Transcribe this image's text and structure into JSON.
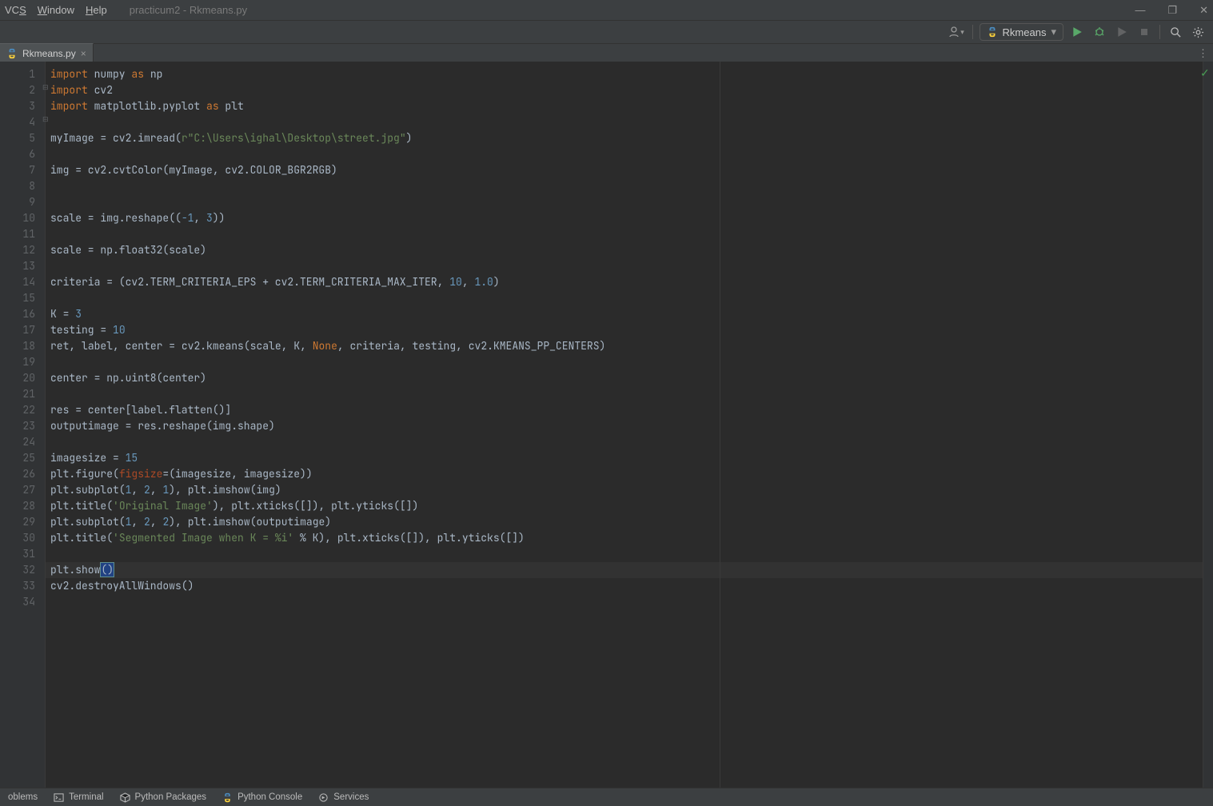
{
  "menu": {
    "vcs": "VCS",
    "window": "Window",
    "help": "Help",
    "project": "practicum2 - Rkmeans.py"
  },
  "winctl": {
    "min": "—",
    "max": "❐",
    "close": "✕"
  },
  "toolbar": {
    "run_config": "Rkmeans"
  },
  "tab": {
    "name": "Rkmeans.py"
  },
  "status": {
    "problems": "oblems",
    "terminal": "Terminal",
    "pypkg": "Python Packages",
    "pyconsole": "Python Console",
    "services": "Services"
  },
  "code_lines": [
    {
      "n": 1,
      "fold": true,
      "seg": [
        {
          "t": "import ",
          "c": "kw"
        },
        {
          "t": "numpy ",
          "c": "def"
        },
        {
          "t": "as ",
          "c": "kw"
        },
        {
          "t": "np",
          "c": "def"
        }
      ]
    },
    {
      "n": 2,
      "seg": [
        {
          "t": "import ",
          "c": "kw"
        },
        {
          "t": "cv2",
          "c": "def"
        }
      ]
    },
    {
      "n": 3,
      "fold": true,
      "seg": [
        {
          "t": "import ",
          "c": "kw"
        },
        {
          "t": "matplotlib.pyplot ",
          "c": "def"
        },
        {
          "t": "as ",
          "c": "kw"
        },
        {
          "t": "plt",
          "c": "def"
        }
      ]
    },
    {
      "n": 4,
      "seg": []
    },
    {
      "n": 5,
      "seg": [
        {
          "t": "myImage = cv2.imread(",
          "c": "def"
        },
        {
          "t": "r\"C:\\Users\\ighal\\Desktop\\street.jpg\"",
          "c": "str"
        },
        {
          "t": ")",
          "c": "def"
        }
      ]
    },
    {
      "n": 6,
      "seg": []
    },
    {
      "n": 7,
      "seg": [
        {
          "t": "img = cv2.cvtColor(myImage",
          "c": "def"
        },
        {
          "t": ", ",
          "c": "op"
        },
        {
          "t": "cv2.COLOR_BGR2RGB)",
          "c": "def"
        }
      ]
    },
    {
      "n": 8,
      "seg": []
    },
    {
      "n": 9,
      "seg": []
    },
    {
      "n": 10,
      "seg": [
        {
          "t": "scale = img.reshape((",
          "c": "def"
        },
        {
          "t": "-1",
          "c": "num"
        },
        {
          "t": ", ",
          "c": "op"
        },
        {
          "t": "3",
          "c": "num"
        },
        {
          "t": "))",
          "c": "def"
        }
      ]
    },
    {
      "n": 11,
      "seg": []
    },
    {
      "n": 12,
      "seg": [
        {
          "t": "scale = np.float32(scale)",
          "c": "def"
        }
      ]
    },
    {
      "n": 13,
      "seg": []
    },
    {
      "n": 14,
      "seg": [
        {
          "t": "criteria = (cv2.TERM_CRITERIA_EPS + cv2.TERM_CRITERIA_MAX_ITER",
          "c": "def"
        },
        {
          "t": ", ",
          "c": "op"
        },
        {
          "t": "10",
          "c": "num"
        },
        {
          "t": ", ",
          "c": "op"
        },
        {
          "t": "1.0",
          "c": "num"
        },
        {
          "t": ")",
          "c": "def"
        }
      ]
    },
    {
      "n": 15,
      "seg": []
    },
    {
      "n": 16,
      "seg": [
        {
          "t": "K = ",
          "c": "def"
        },
        {
          "t": "3",
          "c": "num"
        }
      ]
    },
    {
      "n": 17,
      "seg": [
        {
          "t": "testing = ",
          "c": "def"
        },
        {
          "t": "10",
          "c": "num"
        }
      ]
    },
    {
      "n": 18,
      "seg": [
        {
          "t": "ret",
          "c": "def"
        },
        {
          "t": ", ",
          "c": "op"
        },
        {
          "t": "label",
          "c": "def"
        },
        {
          "t": ", ",
          "c": "op"
        },
        {
          "t": "center = cv2.kmeans(scale",
          "c": "def"
        },
        {
          "t": ", ",
          "c": "op"
        },
        {
          "t": "K",
          "c": "def"
        },
        {
          "t": ", ",
          "c": "op"
        },
        {
          "t": "None",
          "c": "builtin"
        },
        {
          "t": ", ",
          "c": "op"
        },
        {
          "t": "criteria",
          "c": "def"
        },
        {
          "t": ", ",
          "c": "op"
        },
        {
          "t": "testing",
          "c": "def"
        },
        {
          "t": ", ",
          "c": "op"
        },
        {
          "t": "cv2.KMEANS_PP_CENTERS)",
          "c": "def"
        }
      ]
    },
    {
      "n": 19,
      "seg": []
    },
    {
      "n": 20,
      "seg": [
        {
          "t": "center = np.uint8(center)",
          "c": "def"
        }
      ]
    },
    {
      "n": 21,
      "seg": []
    },
    {
      "n": 22,
      "seg": [
        {
          "t": "res = center[label.flatten()]",
          "c": "def"
        }
      ]
    },
    {
      "n": 23,
      "seg": [
        {
          "t": "outputimage = res.reshape(img.shape)",
          "c": "def"
        }
      ]
    },
    {
      "n": 24,
      "seg": []
    },
    {
      "n": 25,
      "seg": [
        {
          "t": "imagesize = ",
          "c": "def"
        },
        {
          "t": "15",
          "c": "num"
        }
      ]
    },
    {
      "n": 26,
      "seg": [
        {
          "t": "plt.figure(",
          "c": "def"
        },
        {
          "t": "figsize",
          "c": "kwarg"
        },
        {
          "t": "=(imagesize",
          "c": "def"
        },
        {
          "t": ", ",
          "c": "op"
        },
        {
          "t": "imagesize))",
          "c": "def"
        }
      ]
    },
    {
      "n": 27,
      "seg": [
        {
          "t": "plt.subplot(",
          "c": "def"
        },
        {
          "t": "1",
          "c": "num"
        },
        {
          "t": ", ",
          "c": "op"
        },
        {
          "t": "2",
          "c": "num"
        },
        {
          "t": ", ",
          "c": "op"
        },
        {
          "t": "1",
          "c": "num"
        },
        {
          "t": ")",
          "c": "def"
        },
        {
          "t": ", ",
          "c": "op"
        },
        {
          "t": "plt.imshow(img)",
          "c": "def"
        }
      ]
    },
    {
      "n": 28,
      "seg": [
        {
          "t": "plt.title(",
          "c": "def"
        },
        {
          "t": "'Original Image'",
          "c": "str"
        },
        {
          "t": ")",
          "c": "def"
        },
        {
          "t": ", ",
          "c": "op"
        },
        {
          "t": "plt.xticks([])",
          "c": "def"
        },
        {
          "t": ", ",
          "c": "op"
        },
        {
          "t": "plt.yticks([])",
          "c": "def"
        }
      ]
    },
    {
      "n": 29,
      "seg": [
        {
          "t": "plt.subplot(",
          "c": "def"
        },
        {
          "t": "1",
          "c": "num"
        },
        {
          "t": ", ",
          "c": "op"
        },
        {
          "t": "2",
          "c": "num"
        },
        {
          "t": ", ",
          "c": "op"
        },
        {
          "t": "2",
          "c": "num"
        },
        {
          "t": ")",
          "c": "def"
        },
        {
          "t": ", ",
          "c": "op"
        },
        {
          "t": "plt.imshow(outputimage)",
          "c": "def"
        }
      ]
    },
    {
      "n": 30,
      "seg": [
        {
          "t": "plt.title(",
          "c": "def"
        },
        {
          "t": "'Segmented Image when K = %i' ",
          "c": "str"
        },
        {
          "t": "% K)",
          "c": "def"
        },
        {
          "t": ", ",
          "c": "op"
        },
        {
          "t": "plt.xticks([])",
          "c": "def"
        },
        {
          "t": ", ",
          "c": "op"
        },
        {
          "t": "plt.yticks([])",
          "c": "def"
        }
      ]
    },
    {
      "n": 31,
      "seg": []
    },
    {
      "n": 32,
      "hl": true,
      "seg": [
        {
          "t": "plt.show",
          "c": "def"
        },
        {
          "t": "()",
          "c": "def",
          "caret": true
        }
      ]
    },
    {
      "n": 33,
      "seg": [
        {
          "t": "cv2.destroyAllWindows()",
          "c": "def"
        }
      ]
    },
    {
      "n": 34,
      "seg": []
    }
  ]
}
